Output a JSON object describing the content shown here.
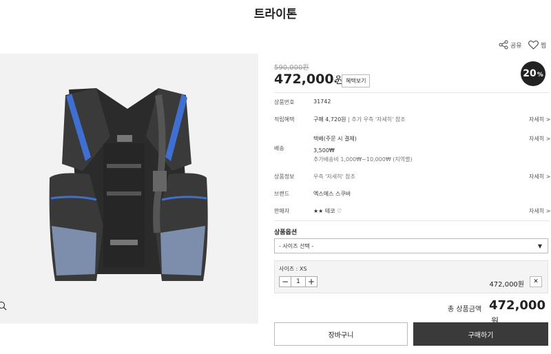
{
  "product": {
    "title": "트라이톤",
    "original_price": "590,000원",
    "price": "472,000",
    "price_unit": "원",
    "price_caret": "▾",
    "detail_button": "혜택보기",
    "discount": "20",
    "discount_unit": "%"
  },
  "actions": {
    "share_label": "공유",
    "wish_label": "찜"
  },
  "info": {
    "code_label": "상품번호",
    "code_value": "31742",
    "benefit_label": "적립혜택",
    "benefit_value": "구매 4,720원",
    "benefit_extra": "추가 우측 '자세히' 참조",
    "benefit_more": "자세히 >",
    "shipping_label": "배송",
    "shipping_type": "택배(주문 시 결제)",
    "shipping_fee": "3,500₩",
    "shipping_extra": "추가배송비 1,000₩~10,000₩ (지역별)",
    "shipping_more": "자세히 >",
    "notice_label": "상품정보",
    "notice_value": "우측 '자세히' 참조",
    "notice_more": "자세히 >",
    "brand_label": "브랜드",
    "brand_value": "엑스에스 스쿠바",
    "seller_label": "판매자",
    "seller_value": "★★ 테코 ♡",
    "seller_more": "자세히 >"
  },
  "options": {
    "title": "상품옵션",
    "select_placeholder": "- 사이즈 선택 -",
    "selected_size": "사이즈 : XS",
    "quantity": "1",
    "line_price": "472,000원",
    "remove": "✕"
  },
  "total": {
    "label": "총 상품금액",
    "amount": "472,000",
    "unit": "원"
  },
  "buttons": {
    "cart": "장바구니",
    "buy": "구매하기"
  },
  "icons": {
    "share": "share-icon",
    "wish": "heart-icon",
    "zoom": "search-icon",
    "caret": "chevron-down-icon"
  },
  "colors": {
    "buy_button": "#3a3a3a",
    "discount_badge": "#222222",
    "vest_accent": "#3f6fd0"
  }
}
